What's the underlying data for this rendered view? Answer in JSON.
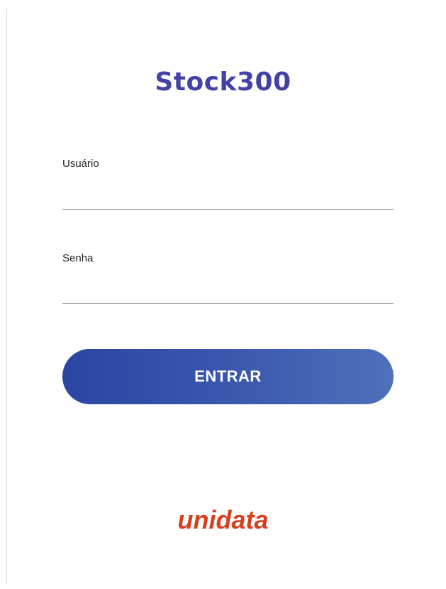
{
  "app": {
    "title": "Stock300"
  },
  "form": {
    "username": {
      "label": "Usuário",
      "value": ""
    },
    "password": {
      "label": "Senha",
      "value": ""
    },
    "submit_label": "ENTRAR"
  },
  "footer": {
    "brand": "unidata"
  },
  "colors": {
    "title": "#4242a8",
    "button_gradient_start": "#2b45a2",
    "button_gradient_end": "#4f70ba",
    "brand": "#d6401f"
  }
}
